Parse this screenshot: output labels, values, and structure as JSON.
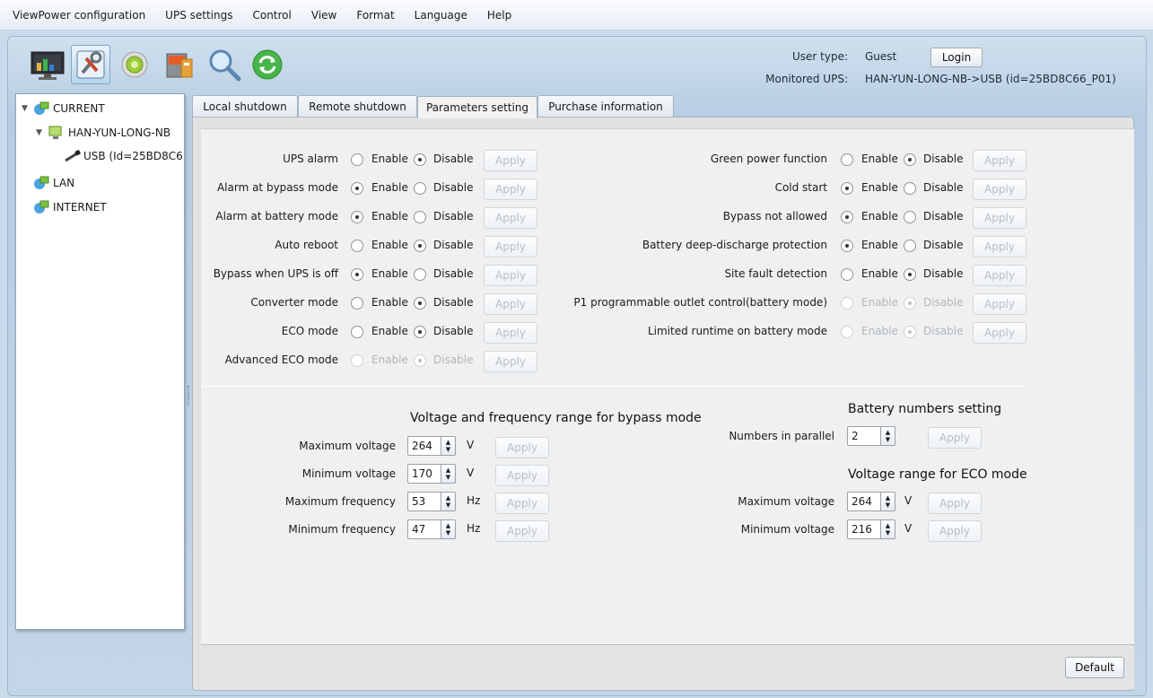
{
  "menu": [
    "ViewPower configuration",
    "UPS settings",
    "Control",
    "View",
    "Format",
    "Language",
    "Help"
  ],
  "header": {
    "user_type_label": "User type:",
    "user_type_value": "Guest",
    "login_label": "Login",
    "monitored_label": "Monitored UPS:",
    "monitored_value": "HAN-YUN-LONG-NB->USB (id=25BD8C66_P01)"
  },
  "toolbar_icons": [
    "monitor-icon",
    "configuration-icon",
    "gear-icon",
    "shutdown-icon",
    "search-icon",
    "refresh-icon"
  ],
  "tree": {
    "current": "CURRENT",
    "host": "HAN-YUN-LONG-NB",
    "usb": "USB (Id=25BD8C6",
    "lan": "LAN",
    "internet": "INTERNET"
  },
  "tabs": [
    "Local shutdown",
    "Remote shutdown",
    "Parameters setting",
    "Purchase information"
  ],
  "active_tab": "Parameters setting",
  "enable_label": "Enable",
  "disable_label": "Disable",
  "apply_label": "Apply",
  "left_params": [
    {
      "label": "UPS alarm",
      "value": "Disable",
      "enabled": true
    },
    {
      "label": "Alarm at bypass mode",
      "value": "Enable",
      "enabled": true
    },
    {
      "label": "Alarm at battery mode",
      "value": "Enable",
      "enabled": true
    },
    {
      "label": "Auto reboot",
      "value": "Disable",
      "enabled": true
    },
    {
      "label": "Bypass when UPS is off",
      "value": "Enable",
      "enabled": true
    },
    {
      "label": "Converter mode",
      "value": "Disable",
      "enabled": true
    },
    {
      "label": "ECO mode",
      "value": "Disable",
      "enabled": true
    },
    {
      "label": "Advanced ECO mode",
      "value": "Disable",
      "enabled": false
    }
  ],
  "right_params": [
    {
      "label": "Green power function",
      "value": "Disable",
      "enabled": true
    },
    {
      "label": "Cold start",
      "value": "Enable",
      "enabled": true
    },
    {
      "label": "Bypass not allowed",
      "value": "Enable",
      "enabled": true
    },
    {
      "label": "Battery deep-discharge protection",
      "value": "Enable",
      "enabled": true
    },
    {
      "label": "Site fault detection",
      "value": "Disable",
      "enabled": true
    },
    {
      "label": "P1 programmable outlet control(battery mode)",
      "value": "Disable",
      "enabled": false
    },
    {
      "label": "Limited runtime on battery mode",
      "value": "Disable",
      "enabled": false
    }
  ],
  "bypass_section": {
    "title": "Voltage and frequency range for bypass mode",
    "rows": [
      {
        "label": "Maximum voltage",
        "value": "264",
        "unit": "V"
      },
      {
        "label": "Minimum voltage",
        "value": "170",
        "unit": "V"
      },
      {
        "label": "Maximum frequency",
        "value": "53",
        "unit": "Hz"
      },
      {
        "label": "Minimum frequency",
        "value": "47",
        "unit": "Hz"
      }
    ]
  },
  "battery_section": {
    "title": "Battery numbers setting",
    "label": "Numbers in parallel",
    "value": "2"
  },
  "eco_section": {
    "title": "Voltage range for ECO mode",
    "rows": [
      {
        "label": "Maximum voltage",
        "value": "264",
        "unit": "V"
      },
      {
        "label": "Minimum voltage",
        "value": "216",
        "unit": "V"
      }
    ]
  },
  "default_label": "Default"
}
